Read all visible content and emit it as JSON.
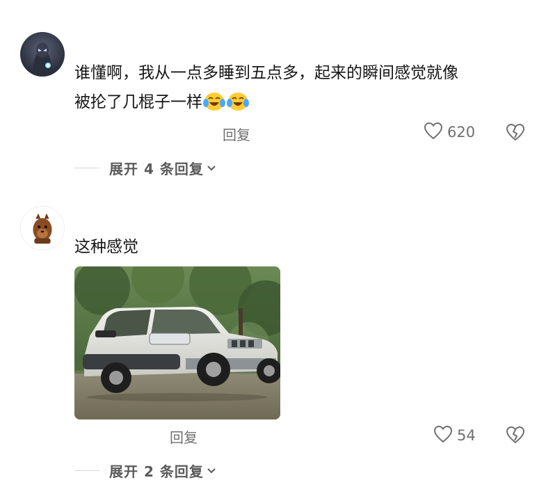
{
  "comments": [
    {
      "text": "谁懂啊，我从一点多睡到五点多，起来的瞬间感觉就像",
      "text_line2": "被抡了几棍子一样",
      "emoji": [
        "cry-laugh-emoji",
        "cry-laugh-emoji"
      ],
      "reply_label": "回复",
      "like_count": "620",
      "expand_label": "展开 4 条回复"
    },
    {
      "text": "这种感觉",
      "image": "photo-white-suv-in-forest",
      "reply_label": "回复",
      "like_count": "54",
      "expand_label": "展开 2 条回复"
    }
  ],
  "icons": {
    "like": "heart-outline-icon",
    "dislike": "broken-heart-icon",
    "expand": "chevron-down-icon"
  },
  "colors": {
    "text": "#161616",
    "secondary": "#6f6f6f",
    "divider": "#d9d9d9"
  }
}
